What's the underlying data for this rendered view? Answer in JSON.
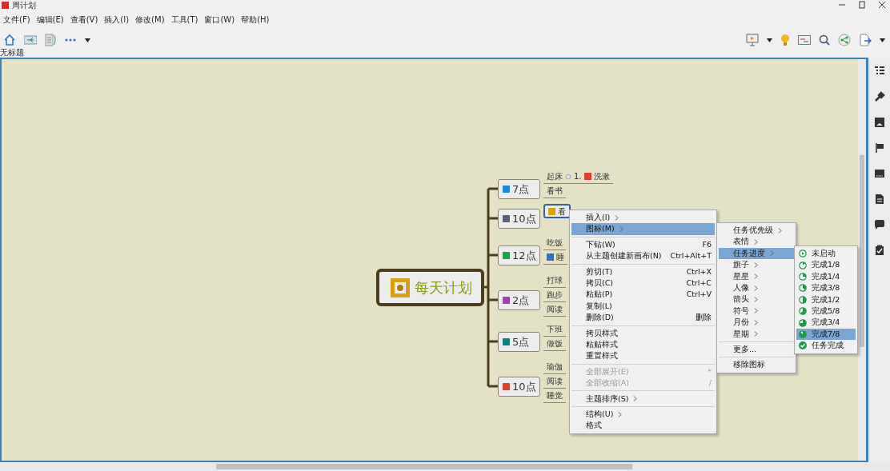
{
  "window": {
    "title": "周计划"
  },
  "menu_bar": [
    "文件(F)",
    "编辑(E)",
    "查看(V)",
    "插入(I)",
    "修改(M)",
    "工具(T)",
    "窗口(W)",
    "帮助(H)"
  ],
  "tab": {
    "label": "无标题"
  },
  "mind_map": {
    "root": {
      "label": "每天计划"
    },
    "branches": [
      {
        "label": "7点",
        "color": "#1e88d8",
        "children": [
          {
            "label": "起床",
            "selected": false,
            "children": [
              {
                "number": "1.",
                "label": "洗漱",
                "color": "#d84030"
              }
            ]
          },
          {
            "label": "看书",
            "selected": false
          }
        ]
      },
      {
        "label": "10点",
        "color": "#5a6078",
        "children": [
          {
            "label": "看",
            "color": "#e0a000",
            "selected": true
          }
        ]
      },
      {
        "label": "12点",
        "color": "#20a050",
        "children": [
          {
            "label": "吃饭",
            "selected": false
          },
          {
            "label": "睡",
            "color": "#3070d0",
            "selected": false
          }
        ]
      },
      {
        "label": "2点",
        "color": "#a040b0",
        "children": [
          {
            "label": "打球",
            "selected": false
          },
          {
            "label": "跑步",
            "selected": false
          },
          {
            "label": "阅读",
            "selected": false
          }
        ]
      },
      {
        "label": "5点",
        "color": "#10807a",
        "children": [
          {
            "label": "下班",
            "selected": false
          },
          {
            "label": "做饭",
            "selected": false
          }
        ]
      },
      {
        "label": "10点",
        "color": "#d84030",
        "children": [
          {
            "label": "瑜伽",
            "selected": false
          },
          {
            "label": "阅读",
            "selected": false
          },
          {
            "label": "睡觉",
            "selected": false
          }
        ]
      }
    ]
  },
  "context_menu": [
    {
      "label": "插入(I)",
      "submenu": true,
      "selected": false,
      "disabled": false
    },
    {
      "label": "图标(M)",
      "submenu": true,
      "selected": true,
      "disabled": false
    },
    {
      "kind": "separator"
    },
    {
      "label": "下钻(W)",
      "shortcut": "F6",
      "selected": false,
      "disabled": false
    },
    {
      "label": "从主题创建新画布(N)",
      "shortcut": "Ctrl+Alt+T",
      "selected": false,
      "disabled": false
    },
    {
      "kind": "separator"
    },
    {
      "label": "剪切(T)",
      "shortcut": "Ctrl+X",
      "selected": false,
      "disabled": false
    },
    {
      "label": "拷贝(C)",
      "shortcut": "Ctrl+C",
      "selected": false,
      "disabled": false
    },
    {
      "label": "粘贴(P)",
      "shortcut": "Ctrl+V",
      "selected": false,
      "disabled": false
    },
    {
      "label": "复制(L)",
      "selected": false,
      "disabled": false
    },
    {
      "label": "删除(D)",
      "shortcut": "删除",
      "selected": false,
      "disabled": false
    },
    {
      "kind": "separator"
    },
    {
      "label": "拷贝样式",
      "selected": false,
      "disabled": false
    },
    {
      "label": "粘贴样式",
      "selected": false,
      "disabled": false
    },
    {
      "label": "重置样式",
      "selected": false,
      "disabled": false
    },
    {
      "kind": "separator"
    },
    {
      "label": "全部展开(E)",
      "shortcut": "*",
      "selected": false,
      "disabled": true
    },
    {
      "label": "全部收缩(A)",
      "shortcut": "/",
      "selected": false,
      "disabled": true
    },
    {
      "kind": "separator"
    },
    {
      "label": "主题排序(S)",
      "submenu": true,
      "selected": false,
      "disabled": false
    },
    {
      "kind": "separator"
    },
    {
      "label": "结构(U)",
      "submenu": true,
      "selected": false,
      "disabled": false
    },
    {
      "label": "格式",
      "selected": false,
      "disabled": false
    }
  ],
  "icon_submenu": [
    {
      "label": "任务优先级",
      "submenu": true,
      "selected": false
    },
    {
      "label": "表情",
      "submenu": true,
      "selected": false
    },
    {
      "label": "任务进度",
      "submenu": true,
      "selected": true
    },
    {
      "label": "旗子",
      "submenu": true,
      "selected": false
    },
    {
      "label": "星星",
      "submenu": true,
      "selected": false
    },
    {
      "label": "人像",
      "submenu": true,
      "selected": false
    },
    {
      "label": "箭头",
      "submenu": true,
      "selected": false
    },
    {
      "label": "符号",
      "submenu": true,
      "selected": false
    },
    {
      "label": "月份",
      "submenu": true,
      "selected": false
    },
    {
      "label": "星期",
      "submenu": true,
      "selected": false
    },
    {
      "kind": "separator"
    },
    {
      "label": "更多...",
      "selected": false
    },
    {
      "kind": "separator"
    },
    {
      "label": "移除图标",
      "selected": false
    }
  ],
  "progress_submenu": [
    {
      "label": "未启动",
      "kind": "start",
      "selected": false
    },
    {
      "label": "完成1/8",
      "kind": "eighth",
      "selected": false
    },
    {
      "label": "完成1/4",
      "kind": "quarter",
      "selected": false
    },
    {
      "label": "完成3/8",
      "kind": "three-eighths",
      "selected": false
    },
    {
      "label": "完成1/2",
      "kind": "half",
      "selected": false
    },
    {
      "label": "完成5/8",
      "kind": "five-eighths",
      "selected": false
    },
    {
      "label": "完成3/4",
      "kind": "three-quarters",
      "selected": false
    },
    {
      "label": "完成7/8",
      "kind": "seven-eighths",
      "selected": true
    },
    {
      "label": "任务完成",
      "kind": "done",
      "selected": false
    }
  ]
}
